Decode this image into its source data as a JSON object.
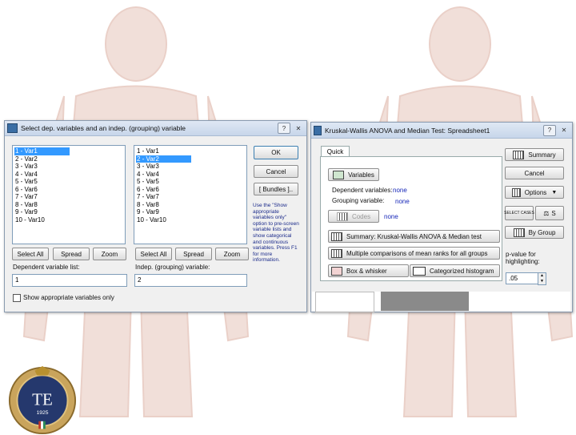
{
  "left_dialog": {
    "title": "Select dep. variables and an indep. (grouping) variable",
    "help_label": "?",
    "dep_list": [
      "1 - Var1",
      "2 - Var2",
      "3 - Var3",
      "4 - Var4",
      "5 - Var5",
      "6 - Var6",
      "7 - Var7",
      "8 - Var8",
      "9 - Var9",
      "10 - Var10"
    ],
    "dep_selected_index": 0,
    "indep_list": [
      "1 - Var1",
      "2 - Var2",
      "3 - Var3",
      "4 - Var4",
      "5 - Var5",
      "6 - Var6",
      "7 - Var7",
      "8 - Var8",
      "9 - Var9",
      "10 - Var10"
    ],
    "indep_selected_index": 1,
    "ok_label": "OK",
    "cancel_label": "Cancel",
    "bundles_label": "[ Bundles ]..",
    "note": "Use the \"Show appropriate variables only\" option to pre-screen variable lists and show categorical and continuous variables. Press F1 for more information.",
    "select_all_label": "Select All",
    "spread_label": "Spread",
    "zoom_label": "Zoom",
    "dep_list_label": "Dependent variable list:",
    "dep_value": "1",
    "indep_label": "Indep. (grouping) variable:",
    "indep_value": "2",
    "show_appropriate_label": "Show appropriate variables only"
  },
  "right_dialog": {
    "title": "Kruskal-Wallis ANOVA and Median Test: Spreadsheet1",
    "help_label": "?",
    "tab_quick": "Quick",
    "variables_label": "Variables",
    "dependent_label": "Dependent variables:",
    "dependent_value": "none",
    "grouping_label": "Grouping variable:",
    "grouping_value": "none",
    "codes_label": "Codes",
    "codes_value": "none",
    "summary_kw_label": "Summary: Kruskal-Wallis ANOVA & Median test",
    "multiple_comparisons_label": "Multiple comparisons of mean ranks for all groups",
    "box_whisker_label": "Box & whisker",
    "categorized_histogram_label": "Categorized histogram",
    "summary_label": "Summary",
    "cancel_label": "Cancel",
    "options_label": "Options",
    "select_cases_label": "SELECT CASES",
    "s_label": "S",
    "by_group_label": "By Group",
    "pvalue_label": "p-value for highlighting:",
    "pvalue": ".05"
  },
  "logo": {
    "letters": "TE",
    "year": "1925"
  }
}
